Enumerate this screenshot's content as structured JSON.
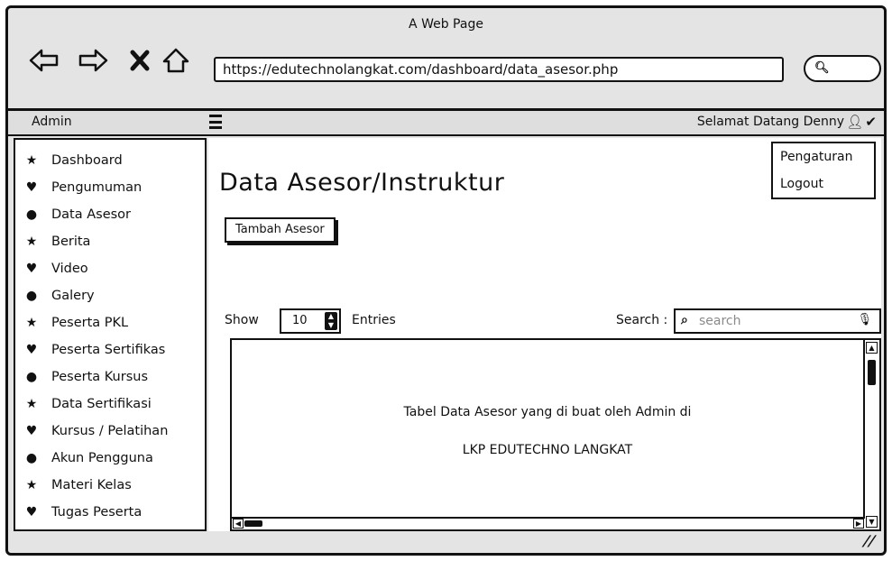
{
  "browser": {
    "window_title": "A Web Page",
    "url": "https://edutechnolangkat.com/dashboard/data_asesor.php"
  },
  "topbar": {
    "admin_label": "Admin",
    "welcome": "Selamat Datang Denny"
  },
  "user_menu": [
    "Pengaturan",
    "Logout"
  ],
  "sidebar": {
    "items": [
      {
        "label": "Dashboard",
        "icon": "star-icon"
      },
      {
        "label": "Pengumuman",
        "icon": "heart-icon"
      },
      {
        "label": "Data Asesor",
        "icon": "circle-icon"
      },
      {
        "label": "Berita",
        "icon": "star-icon"
      },
      {
        "label": "Video",
        "icon": "heart-icon"
      },
      {
        "label": "Galery",
        "icon": "circle-icon"
      },
      {
        "label": "Peserta PKL",
        "icon": "star-icon"
      },
      {
        "label": "Peserta Sertifikas",
        "icon": "heart-icon"
      },
      {
        "label": "Peserta Kursus",
        "icon": "circle-icon"
      },
      {
        "label": "Data Sertifikasi",
        "icon": "star-icon"
      },
      {
        "label": "Kursus / Pelatihan",
        "icon": "heart-icon"
      },
      {
        "label": "Akun Pengguna",
        "icon": "circle-icon"
      },
      {
        "label": "Materi Kelas",
        "icon": "star-icon"
      },
      {
        "label": "Tugas Peserta",
        "icon": "heart-icon"
      }
    ]
  },
  "main": {
    "title": "Data Asesor/Instruktur",
    "add_button": "Tambah Asesor",
    "show_label": "Show",
    "entries_value": "10",
    "entries_label": "Entries",
    "search_label": "Search :",
    "search_placeholder": "search",
    "table_line1": "Tabel Data Asesor yang di buat oleh Admin di",
    "table_line2": "LKP EDUTECHNO LANGKAT"
  }
}
